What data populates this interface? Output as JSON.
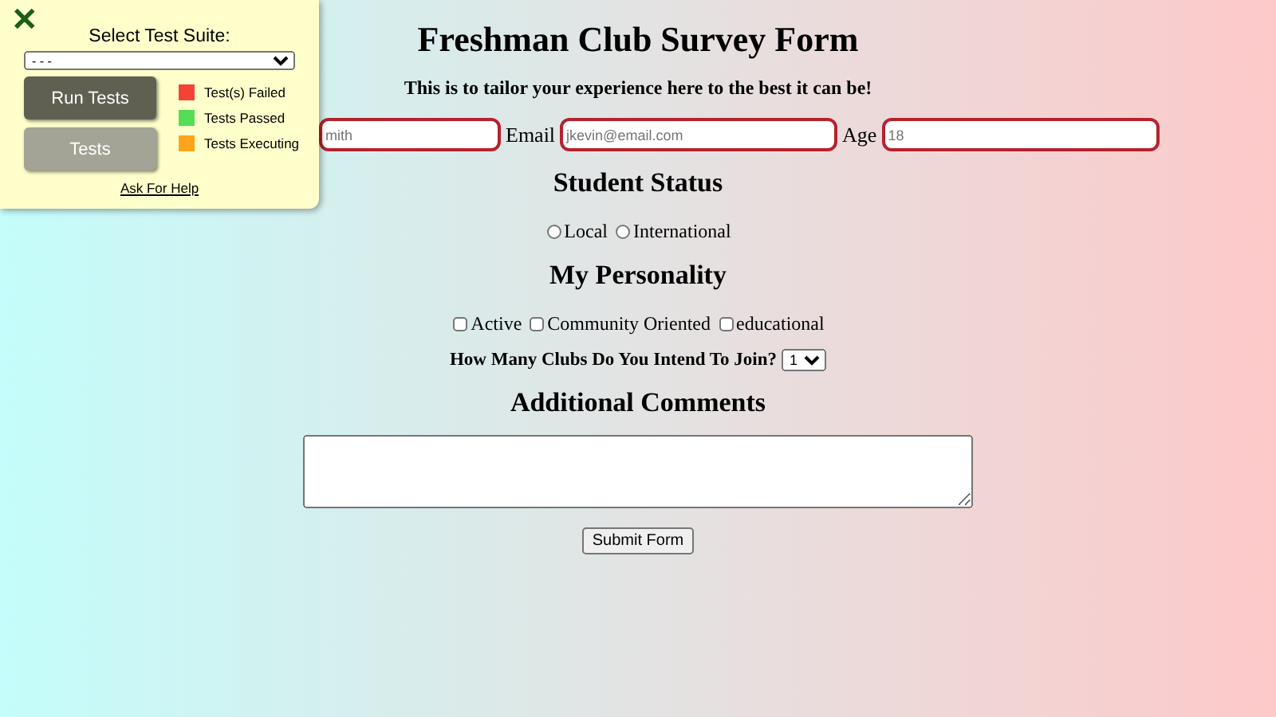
{
  "test_panel": {
    "close": "✕",
    "title": "Select Test Suite:",
    "suite_select": {
      "value": "- - -"
    },
    "buttons": [
      {
        "label": "Run Tests",
        "kind": "primary"
      },
      {
        "label": "Tests",
        "kind": "secondary"
      }
    ],
    "legend": [
      {
        "label": "Test(s) Failed",
        "color": "#f44336"
      },
      {
        "label": "Tests Passed",
        "color": "#55dd55"
      },
      {
        "label": "Tests Executing",
        "color": "#ffa31a"
      }
    ],
    "help_link": "Ask For Help"
  },
  "form": {
    "title": "Freshman Club Survey Form",
    "subtitle": "This is to tailor your experience here to the best it can be!",
    "fields": [
      {
        "placeholder": "mith"
      },
      {
        "label": "Email",
        "placeholder": "jkevin@email.com"
      },
      {
        "label": "Age",
        "placeholder": "18"
      }
    ],
    "status": {
      "heading": "Student Status",
      "options": [
        {
          "label": "Local",
          "selected": false
        },
        {
          "label": "International",
          "selected": false
        }
      ]
    },
    "personality": {
      "heading": "My Personality",
      "options": [
        {
          "label": "Active",
          "checked": false
        },
        {
          "label": "Community Oriented",
          "checked": false
        },
        {
          "label": "educational",
          "checked": false
        }
      ]
    },
    "clubs": {
      "label": "How Many Clubs Do You Intend To Join?",
      "value": "1"
    },
    "comments": {
      "heading": "Additional Comments"
    },
    "submit": "Submit Form"
  }
}
